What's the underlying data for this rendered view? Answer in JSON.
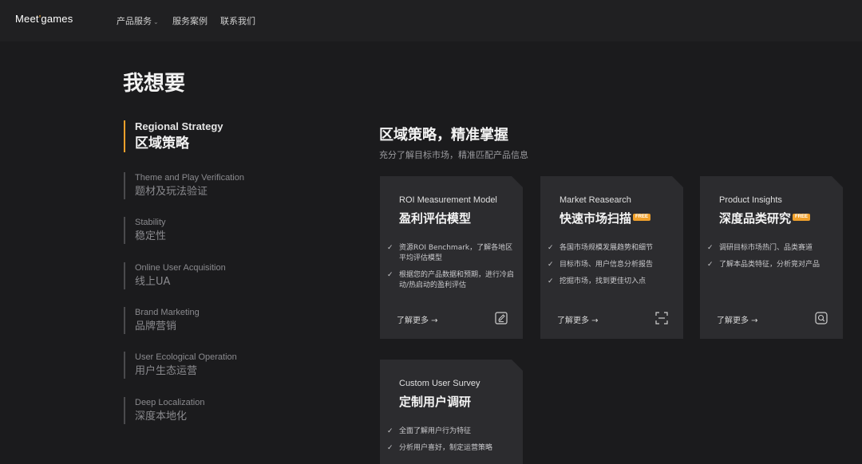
{
  "header": {
    "logo_main": "Meet",
    "logo_accent": "'",
    "logo_rest": "games",
    "nav": [
      {
        "label": "产品服务",
        "has_dropdown": true
      },
      {
        "label": "服务案例",
        "has_dropdown": false
      },
      {
        "label": "联系我们",
        "has_dropdown": false
      }
    ]
  },
  "page_title": "我想要",
  "sidebar": {
    "items": [
      {
        "en": "Regional Strategy",
        "zh": "区域策略",
        "active": true
      },
      {
        "en": "Theme and Play Verification",
        "zh": "题材及玩法验证",
        "active": false
      },
      {
        "en": "Stability",
        "zh": "稳定性",
        "active": false
      },
      {
        "en": "Online User Acquisition",
        "zh": "线上UA",
        "active": false
      },
      {
        "en": "Brand Marketing",
        "zh": "品牌营销",
        "active": false
      },
      {
        "en": "User Ecological Operation",
        "zh": "用户生态运营",
        "active": false
      },
      {
        "en": "Deep Localization",
        "zh": "深度本地化",
        "active": false
      }
    ]
  },
  "section": {
    "title": "区域策略，精准掌握",
    "subtitle": "充分了解目标市场，精准匹配产品信息"
  },
  "cards": [
    {
      "en": "ROI Measurement Model",
      "zh": "盈利评估模型",
      "free": false,
      "features": [
        "资源ROI Benchmark，了解各地区平均评估模型",
        "根据您的产品数据和预期，进行冷启动/热启动的盈利评估"
      ],
      "more": "了解更多 →",
      "icon": "edit-icon"
    },
    {
      "en": "Market Reasearch",
      "zh": "快速市场扫描",
      "free": true,
      "features": [
        "各国市场规模发展趋势和细节",
        "目标市场、用户信息分析报告",
        "挖掘市场，找到更佳切入点"
      ],
      "more": "了解更多 →",
      "icon": "scan-icon"
    },
    {
      "en": "Product Insights",
      "zh": "深度品类研究",
      "free": true,
      "features": [
        "调研目标市场热门、品类赛道",
        "了解本品类特征，分析竞对产品"
      ],
      "more": "了解更多 →",
      "icon": "search-icon"
    },
    {
      "en": "Custom User Survey",
      "zh": "定制用户调研",
      "free": false,
      "features": [
        "全面了解用户行为特征",
        "分析用户喜好，制定运营策略"
      ],
      "more": "",
      "icon": ""
    }
  ],
  "free_badge": "FREE",
  "colors": {
    "accent": "#f0a02b",
    "background": "#1b1b1d",
    "card": "#2c2c2f"
  }
}
